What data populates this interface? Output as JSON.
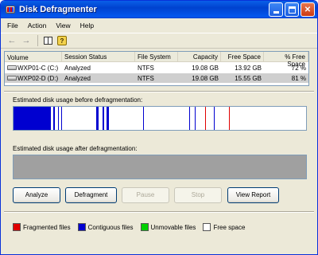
{
  "window": {
    "title": "Disk Defragmenter"
  },
  "menu": [
    {
      "label": "File"
    },
    {
      "label": "Action"
    },
    {
      "label": "View"
    },
    {
      "label": "Help"
    }
  ],
  "volumes": {
    "headers": [
      "Volume",
      "Session Status",
      "File System",
      "Capacity",
      "Free Space",
      "% Free Space"
    ],
    "rows": [
      {
        "volume": "WXP01-C (C:)",
        "status": "Analyzed",
        "fs": "NTFS",
        "capacity": "19.08 GB",
        "free": "13.92 GB",
        "pct": "72 %"
      },
      {
        "volume": "WXP02-D (D:)",
        "status": "Analyzed",
        "fs": "NTFS",
        "capacity": "19.08 GB",
        "free": "15.55 GB",
        "pct": "81 %"
      }
    ]
  },
  "analysis": {
    "before_label": "Estimated disk usage before defragmentation:",
    "after_label": "Estimated disk usage after defragmentation:"
  },
  "buttons": {
    "analyze": "Analyze",
    "defragment": "Defragment",
    "pause": "Pause",
    "stop": "Stop",
    "view_report": "View Report"
  },
  "legend": {
    "fragmented": {
      "label": "Fragmented files",
      "color": "#e00000"
    },
    "contiguous": {
      "label": "Contiguous files",
      "color": "#0000d0"
    },
    "unmovable": {
      "label": "Unmovable files",
      "color": "#00d000"
    },
    "free": {
      "label": "Free space",
      "color": "#ffffff"
    }
  },
  "colors": {
    "after_bar": "#a0a0a0"
  }
}
